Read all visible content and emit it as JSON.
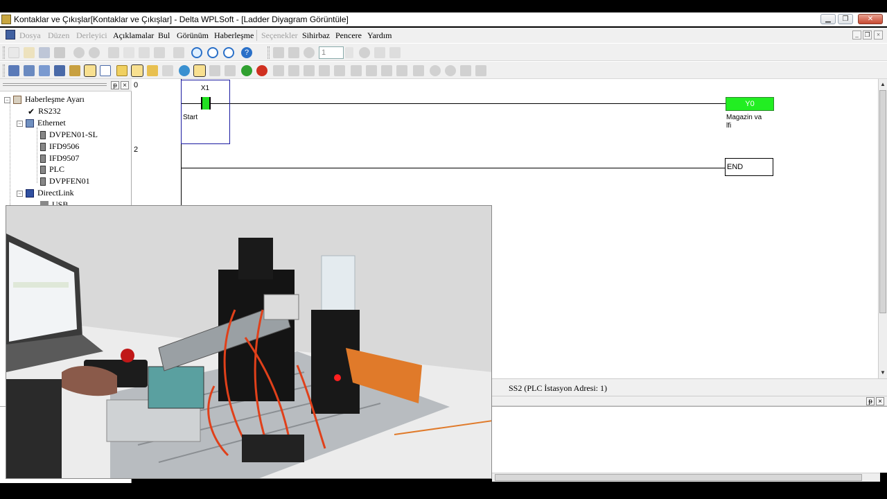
{
  "window": {
    "title": "Kontaklar ve Çıkışlar[Kontaklar ve Çıkışlar] - Delta WPLSoft - [Ladder Diyagram Görüntüle]",
    "minimize": "▁",
    "restore": "❐",
    "close": "✕"
  },
  "menu": {
    "items": [
      {
        "label": "Dosya",
        "disabled": true
      },
      {
        "label": "Düzen",
        "disabled": true
      },
      {
        "label": "Derleyici",
        "disabled": true
      },
      {
        "label": "Açıklamalar",
        "disabled": false
      },
      {
        "label": "Bul",
        "disabled": false
      },
      {
        "label": "Görünüm",
        "disabled": false
      },
      {
        "label": "Haberleşme",
        "disabled": false
      },
      {
        "label": "Seçenekler",
        "disabled": true
      },
      {
        "label": "Sihirbaz",
        "disabled": false
      },
      {
        "label": "Pencere",
        "disabled": false
      },
      {
        "label": "Yardım",
        "disabled": false
      }
    ],
    "mdi_minimize": "_",
    "mdi_restore": "❐",
    "mdi_close": "×"
  },
  "toolbar": {
    "step_value": "1"
  },
  "tree": {
    "pin": "ᵽ",
    "close": "×",
    "root": {
      "label": "Haberleşme Ayarı",
      "expander": "−"
    },
    "rs232": "RS232",
    "ethernet": {
      "label": "Ethernet",
      "expander": "−"
    },
    "ethernet_children": [
      "DVPEN01-SL",
      "IFD9506",
      "IFD9507",
      "PLC",
      "DVPFEN01"
    ],
    "directlink": {
      "label": "DirectLink",
      "expander": "−"
    },
    "usb": "USB"
  },
  "ladder": {
    "rungs": [
      {
        "number": "0",
        "contact": {
          "device": "X1",
          "comment": "Start"
        },
        "coil": {
          "device": "Y0",
          "comment_line1": "Magazin va",
          "comment_line2": "lfi"
        }
      },
      {
        "number": "2",
        "instruction": "END"
      }
    ]
  },
  "status": {
    "station": "SS2 (PLC İstasyon Adresi: 1)"
  },
  "colors": {
    "energized": "#22e022",
    "cursor": "#1a1aa0",
    "background": "#ffffff"
  }
}
